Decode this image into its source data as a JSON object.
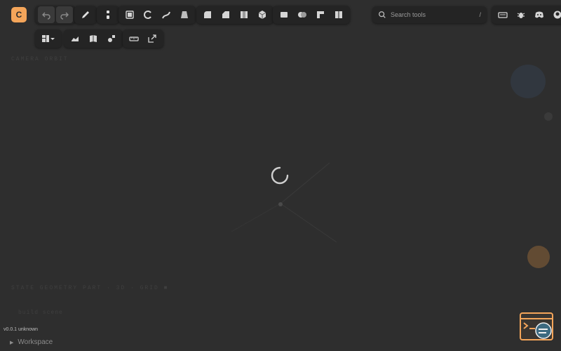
{
  "logo": {
    "letter": "C"
  },
  "search": {
    "placeholder": "Search tools",
    "shortcut": "/"
  },
  "viewport": {
    "overlay_label_top": "CAMERA ORBIT",
    "overlay_label_bottom": "STATE  GEOMETRY  PART  ·  3D  ·  GRID  ■",
    "overlay_label_small": "build scene"
  },
  "footer": {
    "version": "v0.0.1 unknown",
    "workspace_label": "Workspace"
  },
  "colors": {
    "accent": "#f4a55a",
    "toolbar_bg": "#242424",
    "canvas_bg": "#2e2e2e"
  }
}
